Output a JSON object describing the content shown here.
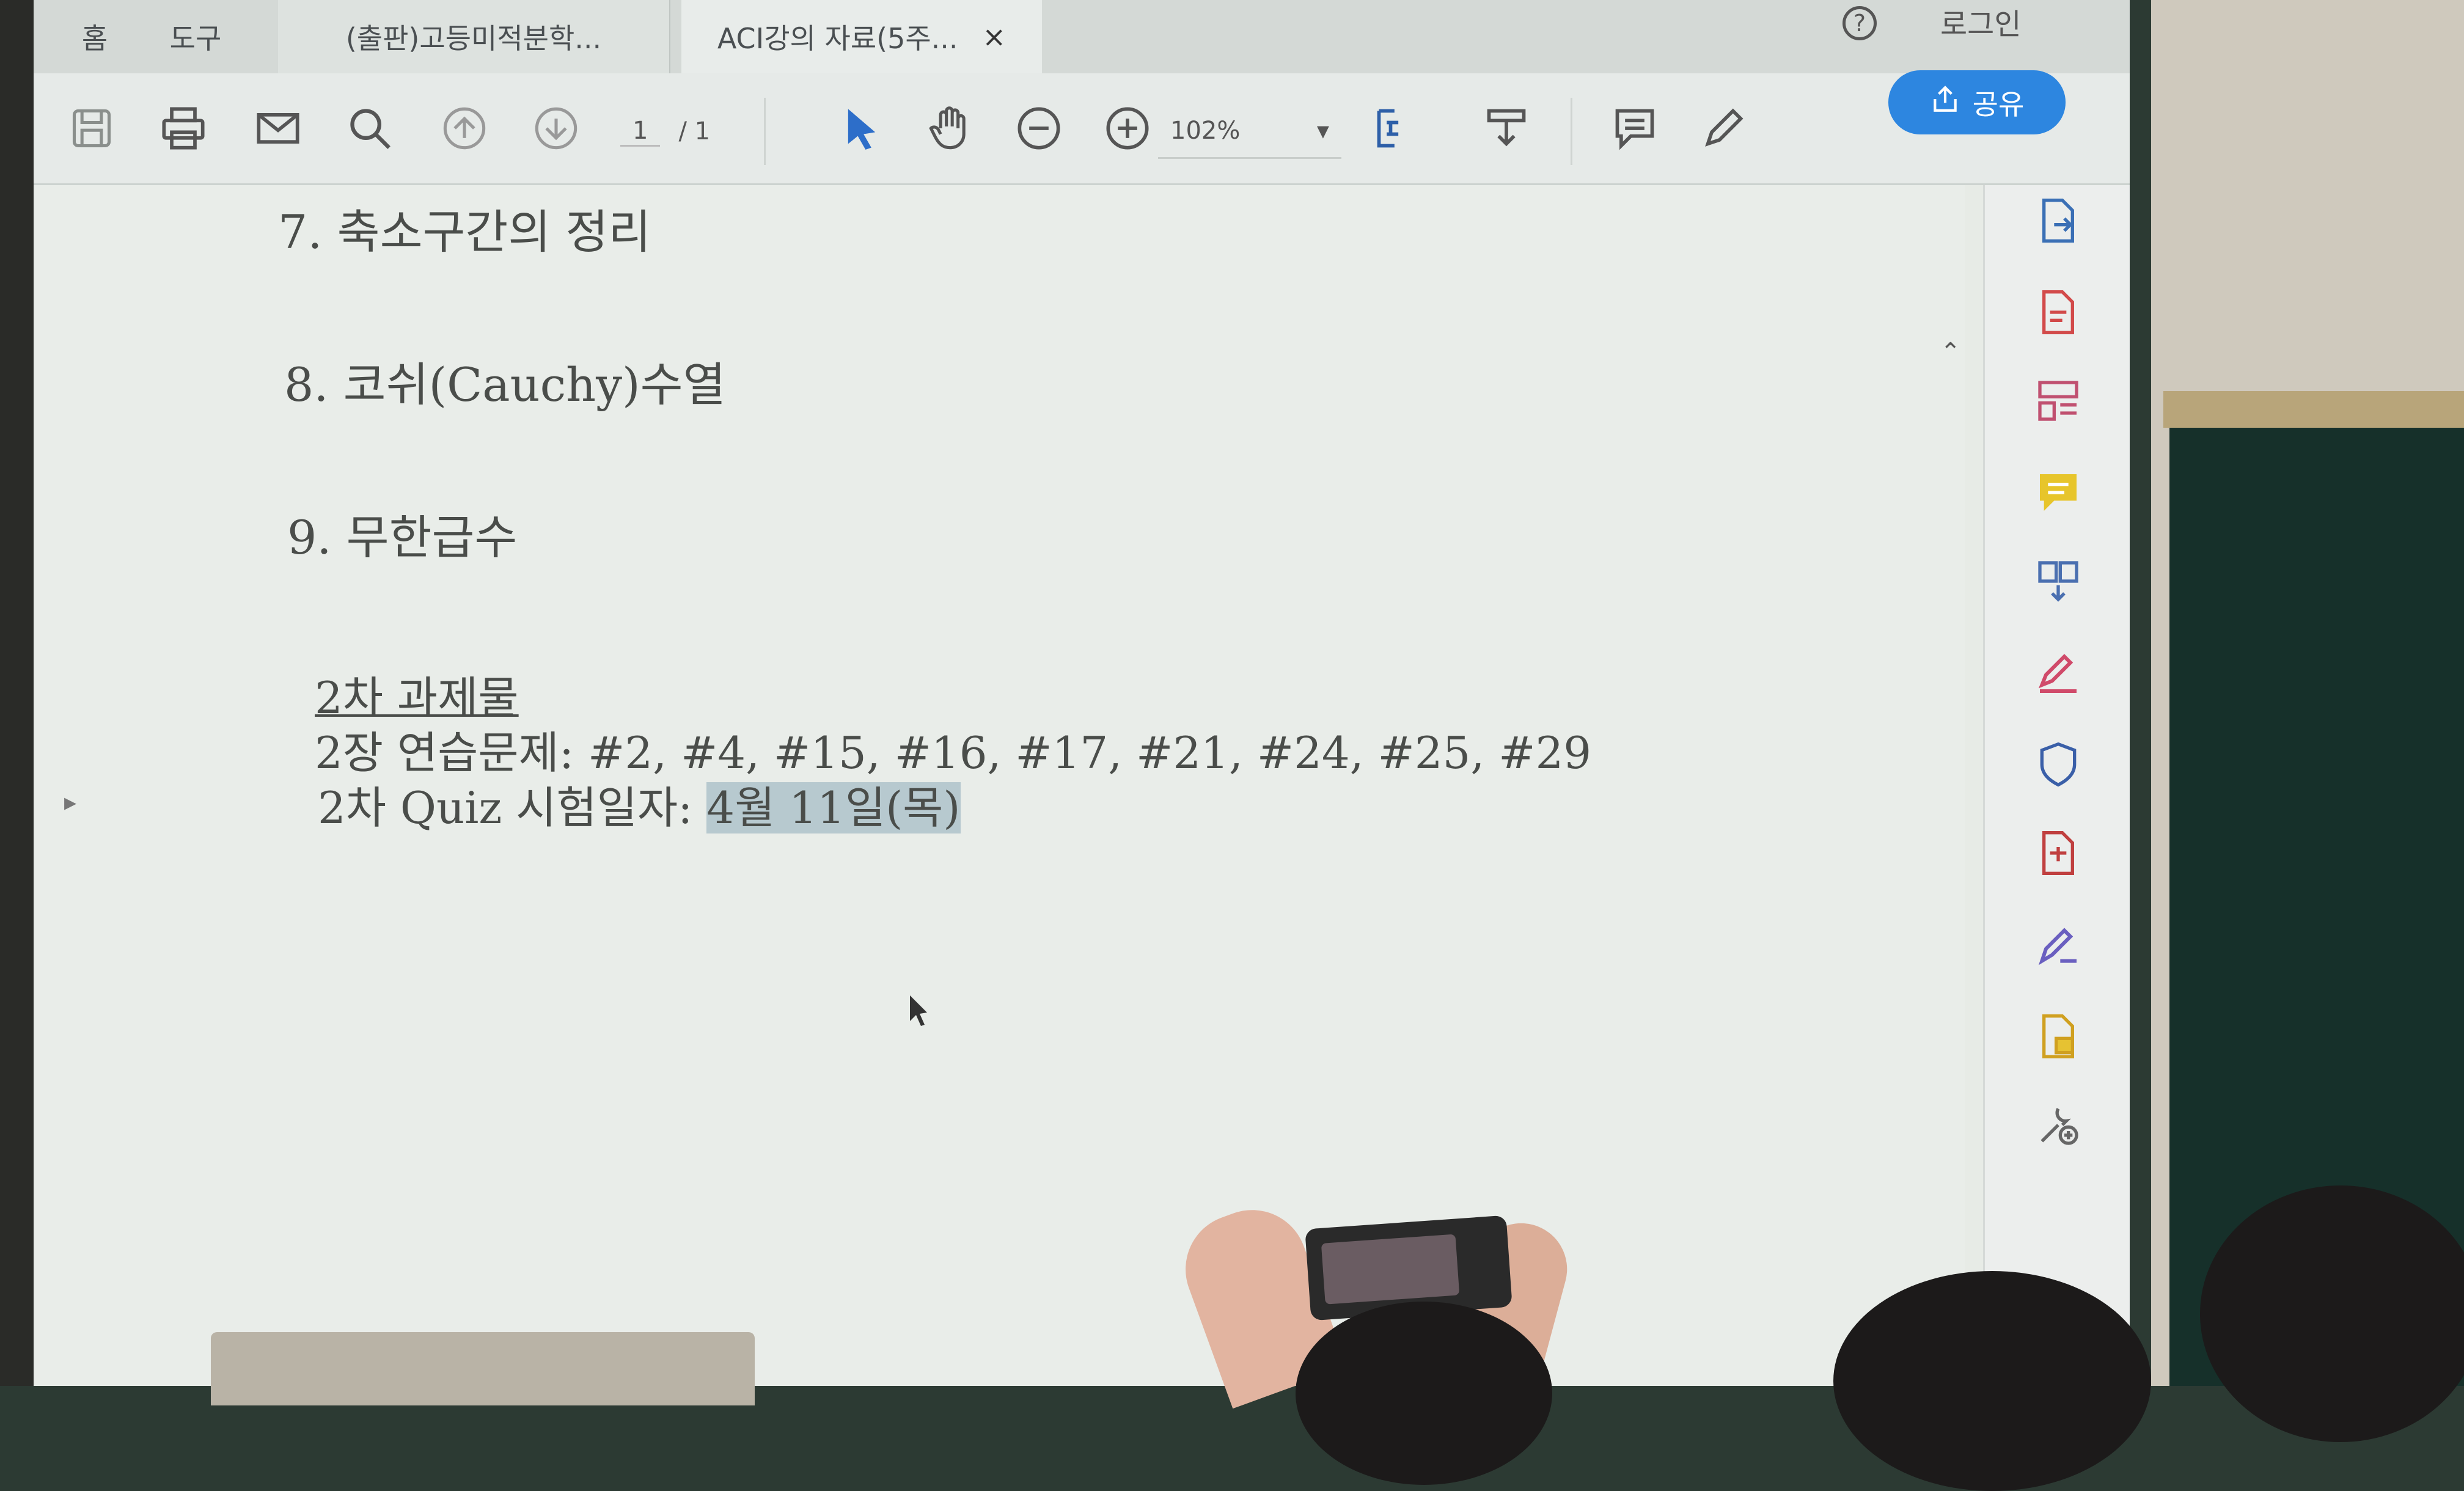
{
  "tabs": {
    "home": "홈",
    "tools": "도구",
    "doc1": "(출판)고등미적분학...",
    "doc2": "ACI강의 자료(5주...",
    "close": "×"
  },
  "header": {
    "help": "?",
    "login": "로그인"
  },
  "toolbar": {
    "page_current": "1",
    "page_total": "/ 1",
    "zoom": "102%",
    "zoom_caret": "▾",
    "share_label": "공유"
  },
  "icons": {
    "toolbar": [
      "save-icon",
      "print-icon",
      "email-icon",
      "search-icon",
      "page-up-icon",
      "page-down-icon",
      "select-pointer-icon",
      "hand-icon",
      "zoom-out-icon",
      "zoom-in-icon",
      "fit-page-icon",
      "scroll-mode-icon",
      "comment-icon",
      "pen-icon",
      "share-icon"
    ],
    "right_panel": [
      "export-pdf-icon",
      "create-pdf-icon",
      "organize-pages-icon",
      "comment-panel-icon",
      "combine-icon",
      "fill-sign-icon",
      "protect-icon",
      "compress-icon",
      "sign-icon",
      "send-icon",
      "more-tools-icon"
    ]
  },
  "colors": {
    "accent": "#2d86e0",
    "highlight": "#b7c9cf",
    "text": "#4a4d4a"
  },
  "document": {
    "item7": "7. 축소구간의 정리",
    "item8": "8. 코쉬(Cauchy)수열",
    "item9": "9. 무한급수",
    "assignment_title": "2차 과제물",
    "assignment_problems": "2장 연습문제: #2, #4, #15, #16, #17, #21, #24, #25, #29",
    "quiz_prefix": "2차 Quiz 시험일자: ",
    "quiz_date": "4월 11일(목)"
  }
}
